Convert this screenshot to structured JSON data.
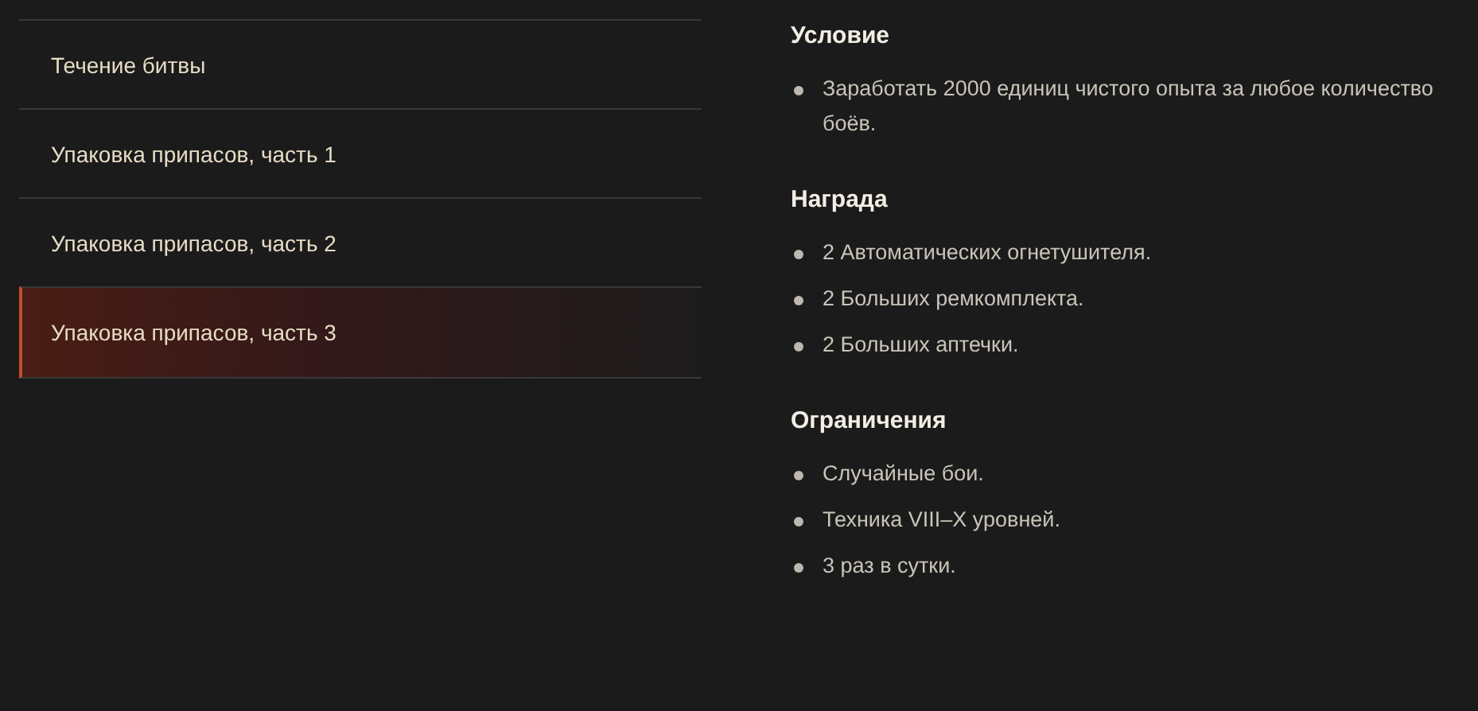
{
  "menu": [
    {
      "label": "Течение битвы",
      "selected": false
    },
    {
      "label": "Упаковка припасов, часть 1",
      "selected": false
    },
    {
      "label": "Упаковка припасов, часть 2",
      "selected": false
    },
    {
      "label": "Упаковка припасов, часть 3",
      "selected": true
    }
  ],
  "sections": [
    {
      "heading": "Условие",
      "items": [
        "Заработать 2000 единиц чистого опыта за любое количество боёв."
      ]
    },
    {
      "heading": "Награда",
      "items": [
        "2 Автоматических огнетушителя.",
        "2 Больших ремкомплекта.",
        "2 Больших аптечки."
      ]
    },
    {
      "heading": "Ограничения",
      "items": [
        "Случайные бои.",
        "Техника VIII–X уровней.",
        "3 раз в сутки."
      ]
    }
  ]
}
